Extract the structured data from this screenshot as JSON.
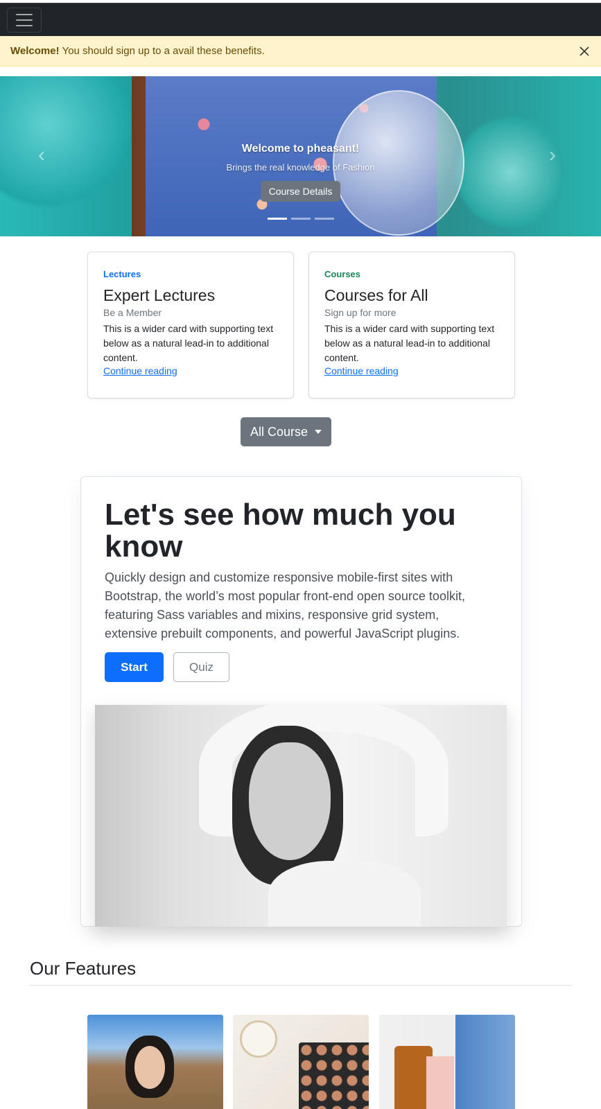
{
  "navbar": {
    "toggler_icon": "hamburger-icon"
  },
  "alert": {
    "strong": "Welcome!",
    "text": "You should sign up to a avail these benefits.",
    "close_icon": "close-icon"
  },
  "carousel": {
    "title": "Welcome to pheasant!",
    "text": "Brings the real knowledge of Fashion",
    "button": "Course Details",
    "prev_icon": "chevron-left-icon",
    "next_icon": "chevron-right-icon",
    "indicator_count": 3,
    "active_indicator": 1
  },
  "cards": [
    {
      "category": "Lectures",
      "category_color": "#0d6efd",
      "title": "Expert Lectures",
      "subtitle": "Be a Member",
      "text": "This is a wider card with supporting text below as a natural lead-in to additional content.",
      "link": "Continue reading"
    },
    {
      "category": "Courses",
      "category_color": "#198754",
      "title": "Courses for All",
      "subtitle": "Sign up for more",
      "text": "This is a wider card with supporting text below as a natural lead-in to additional content.",
      "link": "Continue reading"
    }
  ],
  "dropdown": {
    "label": "All Course"
  },
  "jumbotron": {
    "title": "Let's see how much you know",
    "lead": "Quickly design and customize responsive mobile-first sites with Bootstrap, the world’s most popular front-end open source toolkit, featuring Sass variables and mixins, responsive grid system, extensive prebuilt components, and powerful JavaScript plugins.",
    "primary_button": "Start",
    "secondary_button": "Quiz"
  },
  "features": {
    "title": "Our Features"
  },
  "colors": {
    "navbar_bg": "#212529",
    "alert_bg": "#fff3cd",
    "primary": "#0d6efd",
    "secondary": "#6c757d",
    "success": "#198754"
  }
}
